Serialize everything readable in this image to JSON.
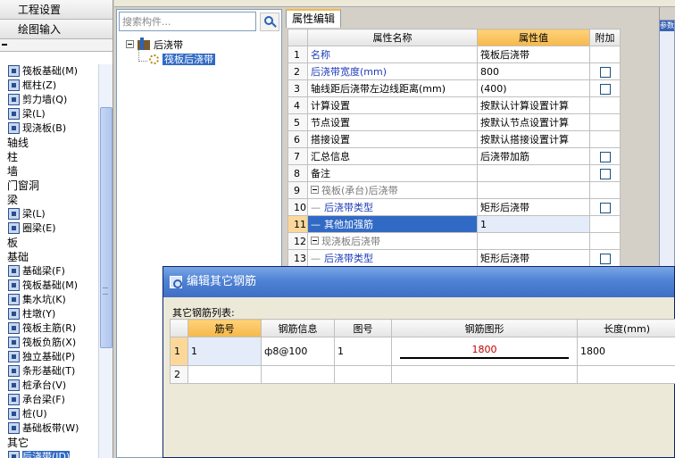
{
  "left_pane": {
    "header_1": "工程设置",
    "header_2": "绘图输入",
    "tree": [
      {
        "type": "item",
        "label": "筏板基础(M)"
      },
      {
        "type": "item",
        "label": "框柱(Z)"
      },
      {
        "type": "item",
        "label": "剪力墙(Q)"
      },
      {
        "type": "item",
        "label": "梁(L)"
      },
      {
        "type": "item",
        "label": "现浇板(B)"
      },
      {
        "type": "cat",
        "label": "轴线"
      },
      {
        "type": "cat",
        "label": "柱"
      },
      {
        "type": "cat",
        "label": "墙"
      },
      {
        "type": "cat",
        "label": "门窗洞"
      },
      {
        "type": "cat",
        "label": "梁"
      },
      {
        "type": "item",
        "label": "梁(L)"
      },
      {
        "type": "item",
        "label": "圈梁(E)"
      },
      {
        "type": "cat",
        "label": "板"
      },
      {
        "type": "cat",
        "label": "基础"
      },
      {
        "type": "item",
        "label": "基础梁(F)"
      },
      {
        "type": "item",
        "label": "筏板基础(M)"
      },
      {
        "type": "item",
        "label": "集水坑(K)"
      },
      {
        "type": "item",
        "label": "柱墩(Y)"
      },
      {
        "type": "item",
        "label": "筏板主筋(R)"
      },
      {
        "type": "item",
        "label": "筏板负筋(X)"
      },
      {
        "type": "item",
        "label": "独立基础(P)"
      },
      {
        "type": "item",
        "label": "条形基础(T)"
      },
      {
        "type": "item",
        "label": "桩承台(V)"
      },
      {
        "type": "item",
        "label": "承台梁(F)"
      },
      {
        "type": "item",
        "label": "桩(U)"
      },
      {
        "type": "item",
        "label": "基础板带(W)"
      },
      {
        "type": "cat",
        "label": "其它"
      },
      {
        "type": "item",
        "label": "后浇带(JD)",
        "selected": true
      }
    ]
  },
  "middle_pane": {
    "search_placeholder": "搜索构件...",
    "root": "后浇带",
    "child": "筏板后浇带"
  },
  "property_pane": {
    "tab": "属性编辑",
    "headers": {
      "name": "属性名称",
      "value": "属性值",
      "extra": "附加"
    },
    "rows": [
      {
        "no": "1",
        "name": "名称",
        "value": "筏板后浇带",
        "checkbox": false,
        "style": "blue"
      },
      {
        "no": "2",
        "name": "后浇带宽度(mm)",
        "value": "800",
        "checkbox": true,
        "style": "blue"
      },
      {
        "no": "3",
        "name": "轴线距后浇带左边线距离(mm)",
        "value": "(400)",
        "checkbox": true,
        "style": "normal"
      },
      {
        "no": "4",
        "name": "计算设置",
        "value": "按默认计算设置计算",
        "checkbox": false,
        "style": "normal"
      },
      {
        "no": "5",
        "name": "节点设置",
        "value": "按默认节点设置计算",
        "checkbox": false,
        "style": "normal"
      },
      {
        "no": "6",
        "name": "搭接设置",
        "value": "按默认搭接设置计算",
        "checkbox": false,
        "style": "normal"
      },
      {
        "no": "7",
        "name": "汇总信息",
        "value": "后浇带加筋",
        "checkbox": true,
        "style": "normal"
      },
      {
        "no": "8",
        "name": "备注",
        "value": "",
        "checkbox": true,
        "style": "normal"
      },
      {
        "no": "9",
        "name": "筏板(承台)后浇带",
        "value": "",
        "checkbox": false,
        "style": "group"
      },
      {
        "no": "10",
        "name": "后浇带类型",
        "value": "矩形后浇带",
        "checkbox": true,
        "style": "child"
      },
      {
        "no": "11",
        "name": "其他加强筋",
        "value": "1",
        "checkbox": false,
        "style": "selected"
      },
      {
        "no": "12",
        "name": "现浇板后浇带",
        "value": "",
        "checkbox": false,
        "style": "group"
      },
      {
        "no": "13",
        "name": "后浇带类型",
        "value": "矩形后浇带",
        "checkbox": true,
        "style": "child"
      }
    ]
  },
  "side_panel": {
    "label": "参数"
  },
  "dialog": {
    "title": "编辑其它钢筋",
    "list_label": "其它钢筋列表:",
    "headers": [
      "筋号",
      "钢筋信息",
      "图号",
      "钢筋图形",
      "长度(mm)"
    ],
    "rows": [
      {
        "no": "1",
        "bar_no": "1",
        "rebar_info": "ф8@100",
        "figure_no": "1",
        "shape_value": "1800",
        "length": "1800"
      },
      {
        "no": "2",
        "bar_no": "",
        "rebar_info": "",
        "figure_no": "",
        "shape_value": "",
        "length": ""
      }
    ]
  }
}
